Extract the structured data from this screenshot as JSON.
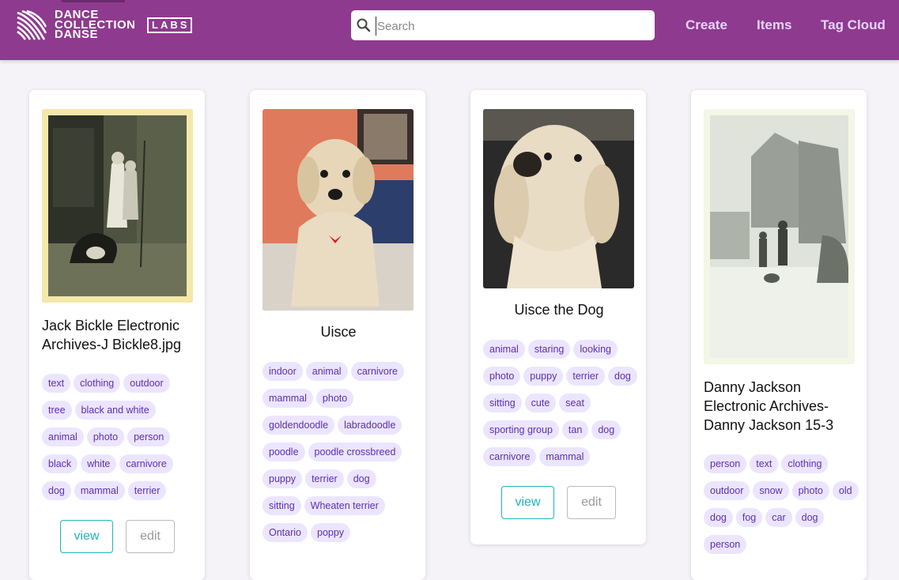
{
  "header": {
    "brand_lines": [
      "DANCE",
      "COLLECTION",
      "DANSE"
    ],
    "labs": "LABS",
    "search_placeholder": "Search",
    "nav": [
      {
        "label": "Create"
      },
      {
        "label": "Items"
      },
      {
        "label": "Tag Cloud"
      }
    ]
  },
  "cards": [
    {
      "title": "Jack Bickle Electronic Archives-J Bickle8.jpg",
      "image": "vintage sepia photo of two women and a dog by a doorway",
      "tags": [
        "text",
        "clothing",
        "outdoor",
        "tree",
        "black and white",
        "animal",
        "photo",
        "person",
        "black",
        "white",
        "carnivore",
        "dog",
        "mammal",
        "terrier"
      ],
      "view_label": "view",
      "edit_label": "edit"
    },
    {
      "title": "Uisce",
      "image": "goldendoodle dog sitting on a bed",
      "tags": [
        "indoor",
        "animal",
        "carnivore",
        "mammal",
        "photo",
        "goldendoodle",
        "labradoodle",
        "poodle",
        "poodle crossbreed",
        "puppy",
        "terrier",
        "dog",
        "sitting",
        "Wheaten terrier",
        "Ontario",
        "poppy"
      ]
    },
    {
      "title": "Uisce the Dog",
      "image": "close-up of a fluffy cream dog",
      "tags": [
        "animal",
        "staring",
        "looking",
        "photo",
        "puppy",
        "terrier",
        "dog",
        "sitting",
        "cute",
        "seat",
        "sporting group",
        "tan",
        "dog",
        "carnivore",
        "mammal"
      ],
      "view_label": "view",
      "edit_label": "edit"
    },
    {
      "title": "Danny Jackson Electronic Archives-Danny Jackson 15-3",
      "image": "faded black and white photo of two boys and a dog on a snowy street",
      "tags": [
        "person",
        "text",
        "clothing",
        "outdoor",
        "snow",
        "photo",
        "old",
        "dog",
        "fog",
        "car",
        "dog",
        "person"
      ]
    }
  ],
  "colors": {
    "header_bg": "#8e3a8e",
    "nav_text": "#e6d4ff",
    "tag_bg": "#ece5ff",
    "tag_text": "#5b2fb0",
    "view_button": "#1fb3b8"
  }
}
